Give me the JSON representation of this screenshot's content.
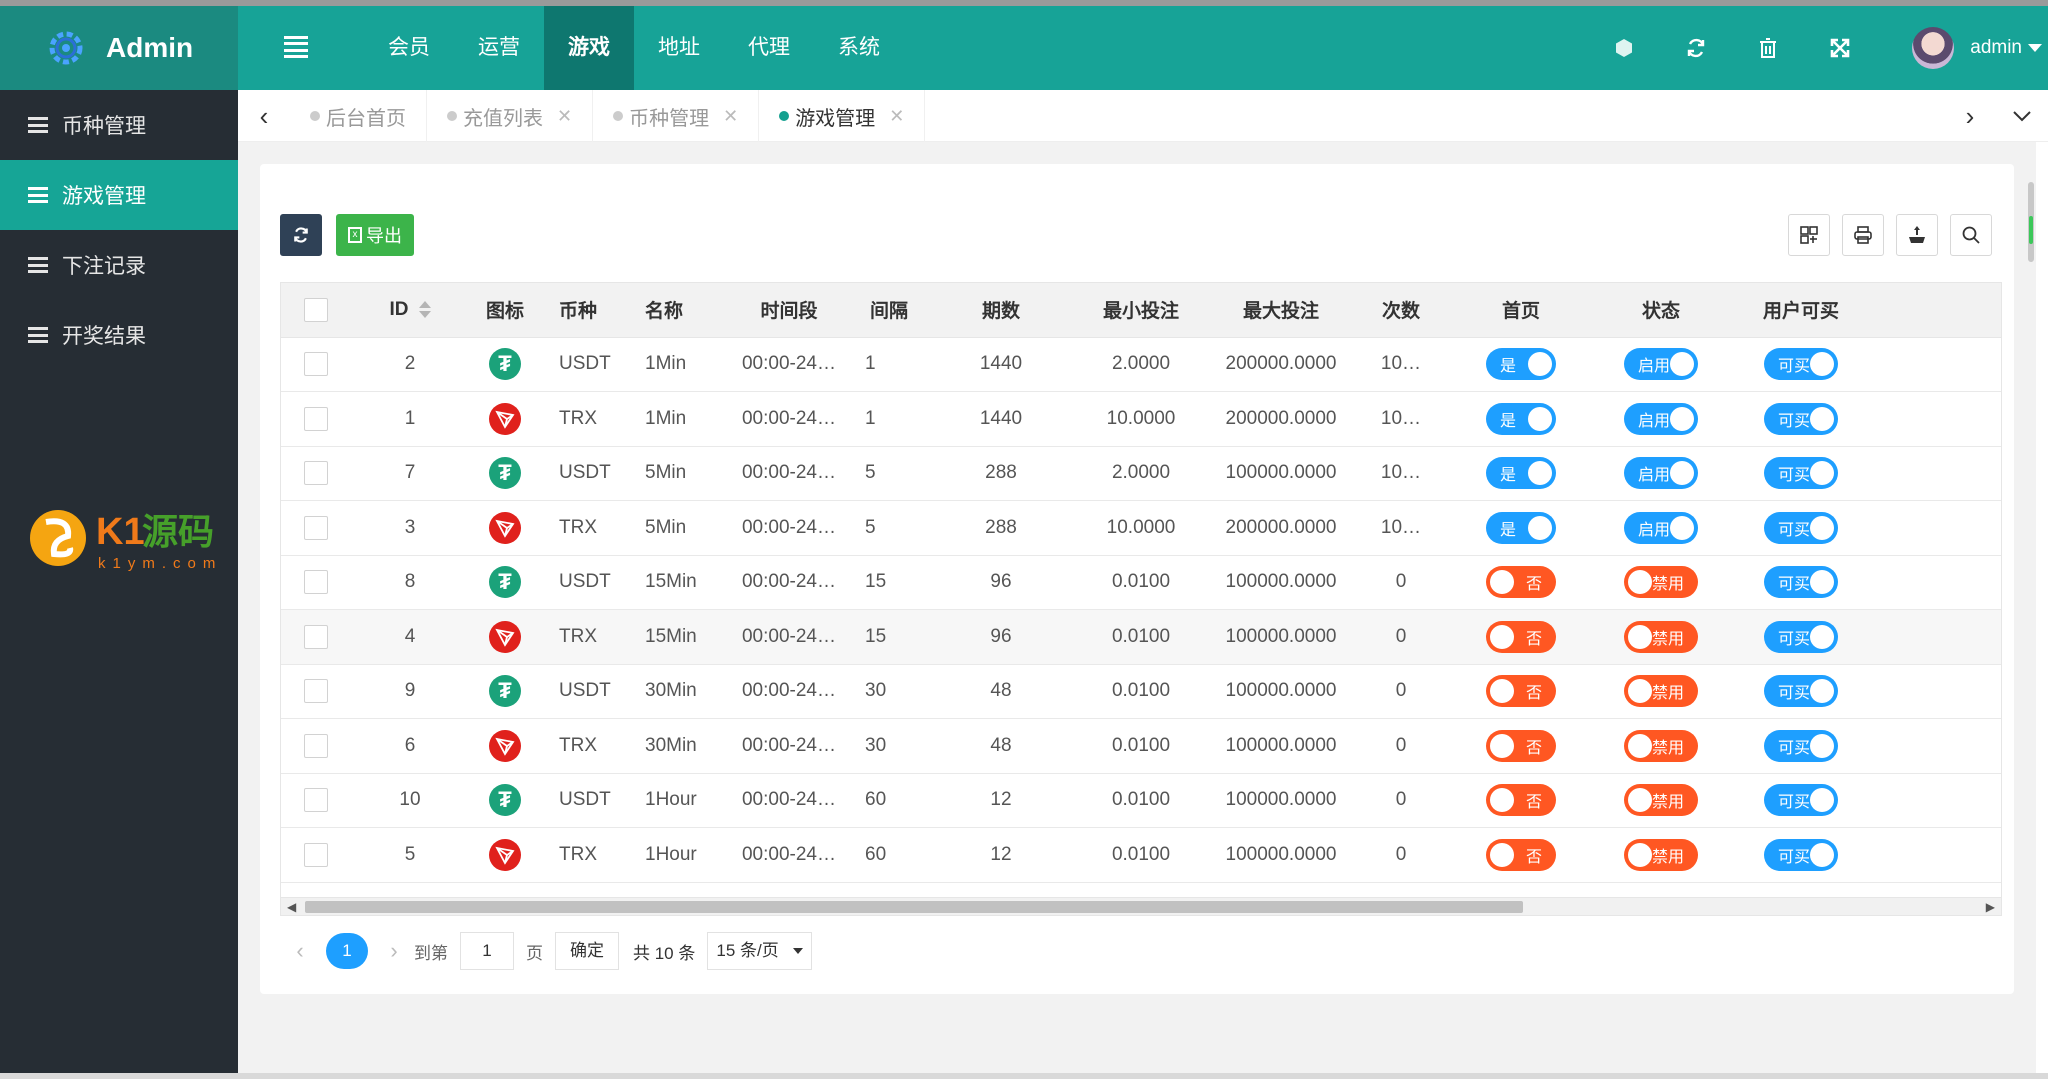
{
  "app": {
    "title": "Admin"
  },
  "colors": {
    "teal": "#17a397",
    "sidebar": "#262d34",
    "switch_on": "#1e9fff",
    "switch_off": "#ff5722"
  },
  "sidebar": {
    "items": [
      {
        "label": "币种管理"
      },
      {
        "label": "游戏管理",
        "active": true
      },
      {
        "label": "下注记录"
      },
      {
        "label": "开奖结果"
      }
    ],
    "watermark": {
      "brand": "K1源码",
      "site": "k1ym.com"
    }
  },
  "header": {
    "nav": [
      "会员",
      "运营",
      "游戏",
      "地址",
      "代理",
      "系统"
    ],
    "active_nav": "游戏",
    "user": "admin"
  },
  "tabs": [
    {
      "label": "后台首页"
    },
    {
      "label": "充值列表"
    },
    {
      "label": "币种管理"
    },
    {
      "label": "游戏管理",
      "active": true
    }
  ],
  "toolbar": {
    "export_label": "导出"
  },
  "table": {
    "headers": [
      "ID",
      "图标",
      "币种",
      "名称",
      "时间段",
      "间隔",
      "期数",
      "最小投注",
      "最大投注",
      "次数",
      "首页",
      "状态",
      "用户可买"
    ],
    "rows": [
      {
        "id": "2",
        "coin": "USDT",
        "name": "1Min",
        "period": "00:00-24…",
        "interval": "1",
        "issues": "1440",
        "min": "2.0000",
        "max": "200000.0000",
        "count": "10…",
        "home": "是",
        "status": "启用",
        "buy": "可买"
      },
      {
        "id": "1",
        "coin": "TRX",
        "name": "1Min",
        "period": "00:00-24…",
        "interval": "1",
        "issues": "1440",
        "min": "10.0000",
        "max": "200000.0000",
        "count": "10…",
        "home": "是",
        "status": "启用",
        "buy": "可买"
      },
      {
        "id": "7",
        "coin": "USDT",
        "name": "5Min",
        "period": "00:00-24…",
        "interval": "5",
        "issues": "288",
        "min": "2.0000",
        "max": "100000.0000",
        "count": "10…",
        "home": "是",
        "status": "启用",
        "buy": "可买"
      },
      {
        "id": "3",
        "coin": "TRX",
        "name": "5Min",
        "period": "00:00-24…",
        "interval": "5",
        "issues": "288",
        "min": "10.0000",
        "max": "200000.0000",
        "count": "10…",
        "home": "是",
        "status": "启用",
        "buy": "可买"
      },
      {
        "id": "8",
        "coin": "USDT",
        "name": "15Min",
        "period": "00:00-24…",
        "interval": "15",
        "issues": "96",
        "min": "0.0100",
        "max": "100000.0000",
        "count": "0",
        "home": "否",
        "status": "禁用",
        "buy": "可买"
      },
      {
        "id": "4",
        "coin": "TRX",
        "name": "15Min",
        "period": "00:00-24…",
        "interval": "15",
        "issues": "96",
        "min": "0.0100",
        "max": "100000.0000",
        "count": "0",
        "home": "否",
        "status": "禁用",
        "buy": "可买"
      },
      {
        "id": "9",
        "coin": "USDT",
        "name": "30Min",
        "period": "00:00-24…",
        "interval": "30",
        "issues": "48",
        "min": "0.0100",
        "max": "100000.0000",
        "count": "0",
        "home": "否",
        "status": "禁用",
        "buy": "可买"
      },
      {
        "id": "6",
        "coin": "TRX",
        "name": "30Min",
        "period": "00:00-24…",
        "interval": "30",
        "issues": "48",
        "min": "0.0100",
        "max": "100000.0000",
        "count": "0",
        "home": "否",
        "status": "禁用",
        "buy": "可买"
      },
      {
        "id": "10",
        "coin": "USDT",
        "name": "1Hour",
        "period": "00:00-24…",
        "interval": "60",
        "issues": "12",
        "min": "0.0100",
        "max": "100000.0000",
        "count": "0",
        "home": "否",
        "status": "禁用",
        "buy": "可买"
      },
      {
        "id": "5",
        "coin": "TRX",
        "name": "1Hour",
        "period": "00:00-24…",
        "interval": "60",
        "issues": "12",
        "min": "0.0100",
        "max": "100000.0000",
        "count": "0",
        "home": "否",
        "status": "禁用",
        "buy": "可买"
      }
    ]
  },
  "pager": {
    "current": "1",
    "goto_label": "到第",
    "goto_value": "1",
    "page_unit": "页",
    "confirm": "确定",
    "total": "共 10 条",
    "page_size": "15 条/页"
  }
}
